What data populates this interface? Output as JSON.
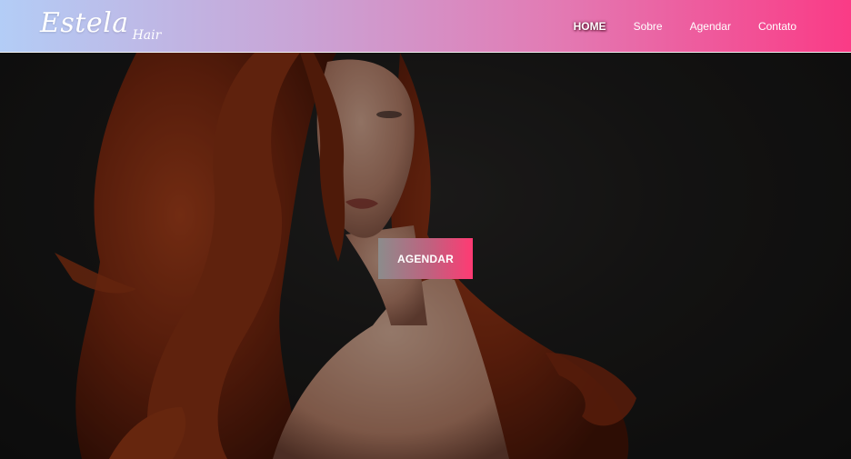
{
  "header": {
    "logo_main": "Estela",
    "logo_sub": "Hair",
    "nav": [
      {
        "label": "HOME"
      },
      {
        "label": "Sobre"
      },
      {
        "label": "Agendar"
      },
      {
        "label": "Contato"
      }
    ]
  },
  "hero": {
    "cta_label": "AGENDAR"
  },
  "colors": {
    "header_gradient_start": "#b3cdf6",
    "header_gradient_end": "#fa3b86",
    "cta_gradient_start": "#8c8c8c",
    "cta_gradient_end": "#ff3a73",
    "hair": "#8a2e12"
  }
}
